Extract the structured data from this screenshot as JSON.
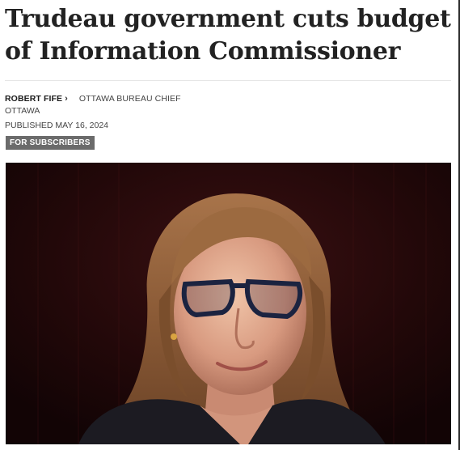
{
  "article": {
    "headline": "Trudeau government cuts budget of Information Commissioner",
    "author": "ROBERT FIFE",
    "author_role": "OTTAWA BUREAU CHIEF",
    "dateline": "OTTAWA",
    "published": "PUBLISHED MAY 16, 2024",
    "badge": "FOR SUBSCRIBERS"
  },
  "icons": {
    "author_link": "chevron-right-icon"
  }
}
